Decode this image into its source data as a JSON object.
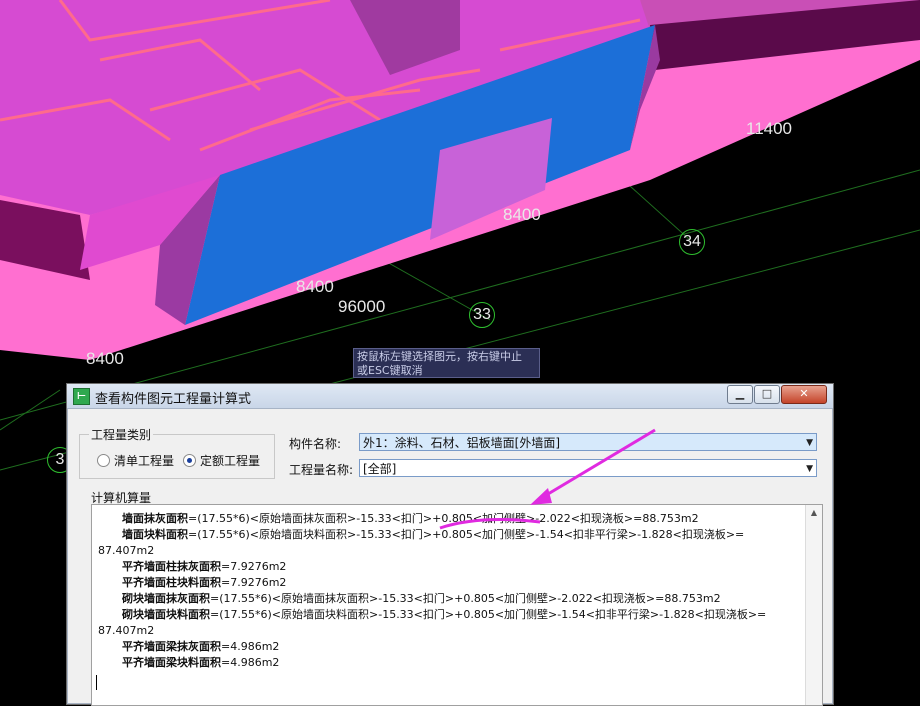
{
  "scene": {
    "dimensions": [
      "11400",
      "8400",
      "34",
      "96000",
      "33",
      "8400",
      "8400",
      "3"
    ],
    "colors": {
      "slab": "#e83fd8",
      "wall": "#1e6fd9",
      "ground": "#ff7ad2"
    }
  },
  "tooltip": {
    "line1": "按鼠标左键选择图元，按右键中止",
    "line2": "或ESC键取消"
  },
  "dialog": {
    "title": "查看构件图元工程量计算式",
    "icon": "app-icon",
    "buttons": {
      "minimize": "▁",
      "maximize": "□",
      "close": "✕"
    },
    "quantity_type": {
      "legend": "工程量类别",
      "options": [
        "清单工程量",
        "定额工程量"
      ],
      "selected": "定额工程量"
    },
    "component_name": {
      "label": "构件名称:",
      "value": "外1：涂料、石材、铝板墙面[外墙面]"
    },
    "quantity_name": {
      "label": "工程量名称:",
      "value": "[全部]"
    },
    "calc_label": "计算机算量",
    "calc_lines": [
      {
        "name": "墙面抹灰面积",
        "formula": "=(17.55*6)<原始墙面抹灰面积>-15.33<扣门>+0.805<加门侧壁>-2.022<扣现浇板>=88.753m2"
      },
      {
        "name": "墙面块料面积",
        "formula": "=(17.55*6)<原始墙面块料面积>-15.33<扣门>+0.805<加门侧壁>-1.54<扣非平行梁>-1.828<扣现浇板>="
      },
      {
        "name": "",
        "formula": "87.407m2",
        "noindent": true
      },
      {
        "name": "平齐墙面柱抹灰面积",
        "formula": "=7.9276m2"
      },
      {
        "name": "平齐墙面柱块料面积",
        "formula": "=7.9276m2"
      },
      {
        "name": "砌块墙面抹灰面积",
        "formula": "=(17.55*6)<原始墙面抹灰面积>-15.33<扣门>+0.805<加门侧壁>-2.022<扣现浇板>=88.753m2"
      },
      {
        "name": "砌块墙面块料面积",
        "formula": "=(17.55*6)<原始墙面块料面积>-15.33<扣门>+0.805<加门侧壁>-1.54<扣非平行梁>-1.828<扣现浇板>="
      },
      {
        "name": "",
        "formula": "87.407m2",
        "noindent": true
      },
      {
        "name": "平齐墙面梁抹灰面积",
        "formula": "=4.986m2"
      },
      {
        "name": "平齐墙面梁块料面积",
        "formula": "=4.986m2"
      }
    ]
  },
  "annotation": {
    "color": "#e02ae0"
  }
}
